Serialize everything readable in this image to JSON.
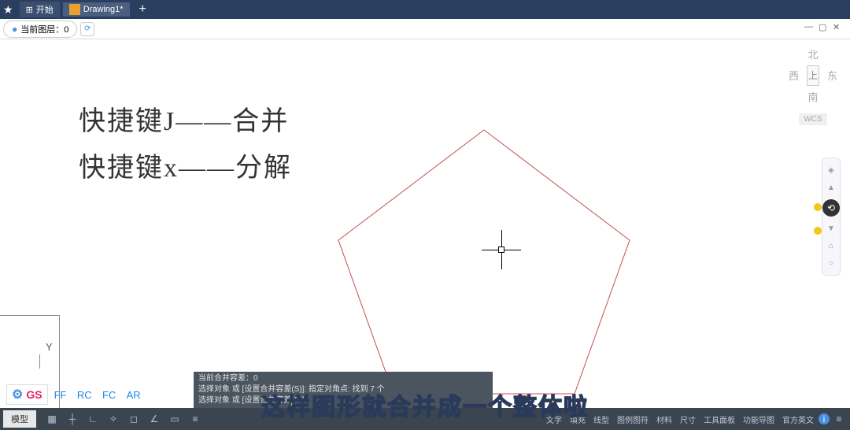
{
  "titlebar": {
    "start_label": "开始",
    "tab_label": "Drawing1*",
    "plus": "+"
  },
  "layer": {
    "label": "当前图层：0"
  },
  "handwriting": {
    "line1": "快捷键J——合并",
    "line2": "快捷键x——分解"
  },
  "axis": {
    "y": "Y"
  },
  "navcube": {
    "north": "北",
    "west": "西",
    "top": "上",
    "east": "东",
    "south": "南",
    "wcs": "WCS"
  },
  "gs": {
    "logo": "GS",
    "codes": [
      "FF",
      "RC",
      "FC",
      "AR"
    ]
  },
  "command": {
    "line1": "当前合并容差：0",
    "line2": "选择对象 或 [设置合并容差(S)]: 指定对角点: 找到 7 个",
    "line3": "选择对象 或 [设置合并容差(S)]:"
  },
  "statusbar": {
    "model": "模型",
    "right_items": [
      "文字",
      "填充",
      "线型",
      "图例图符",
      "材料",
      "尺寸",
      "工具面板",
      "功能导图",
      "官方英文"
    ]
  },
  "subtitle": "这样图形就合并成一个整体啦"
}
